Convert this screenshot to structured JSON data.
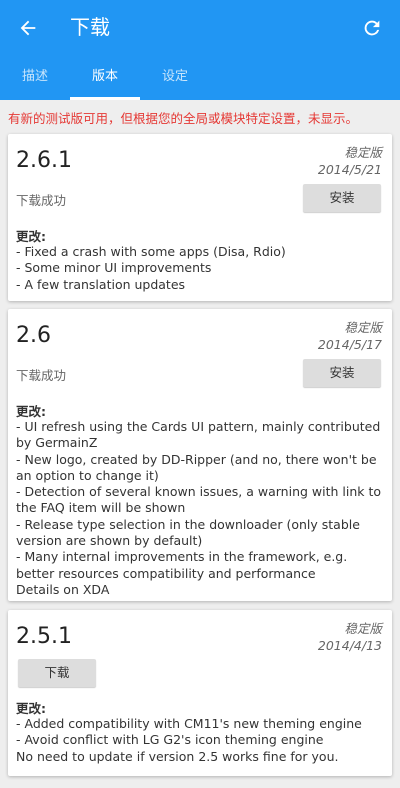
{
  "header": {
    "title": "下载",
    "tabs": [
      "描述",
      "版本",
      "设定"
    ],
    "active_tab": 1
  },
  "notice": "有新的测试版可用，但根据您的全局或模块特定设置，未显示。",
  "versions": [
    {
      "version": "2.6.1",
      "type": "稳定版",
      "date": "2014/5/21",
      "status": "下载成功",
      "button": "安装",
      "changes_title": "更改:",
      "changes": [
        "- Fixed a crash with some apps (Disa, Rdio)",
        "- Some minor UI improvements",
        "- A few translation updates"
      ]
    },
    {
      "version": "2.6",
      "type": "稳定版",
      "date": "2014/5/17",
      "status": "下载成功",
      "button": "安装",
      "changes_title": "更改:",
      "changes": [
        "- UI refresh using the Cards UI pattern, mainly contributed by GermainZ",
        "- New logo, created by DD-Ripper (and no, there won't be an option to change it)",
        "- Detection of several known issues, a warning with link to the FAQ item will be shown",
        "- Release type selection in the downloader (only stable version are shown by default)",
        "- Many internal improvements in the framework, e.g. better resources compatibility and performance",
        "Details on XDA"
      ]
    },
    {
      "version": "2.5.1",
      "type": "稳定版",
      "date": "2014/4/13",
      "button": "下载",
      "changes_title": "更改:",
      "changes": [
        "- Added compatibility with CM11's new theming engine",
        "- Avoid conflict with LG G2's icon theming engine",
        "No need to update if version 2.5 works fine for you."
      ]
    }
  ]
}
